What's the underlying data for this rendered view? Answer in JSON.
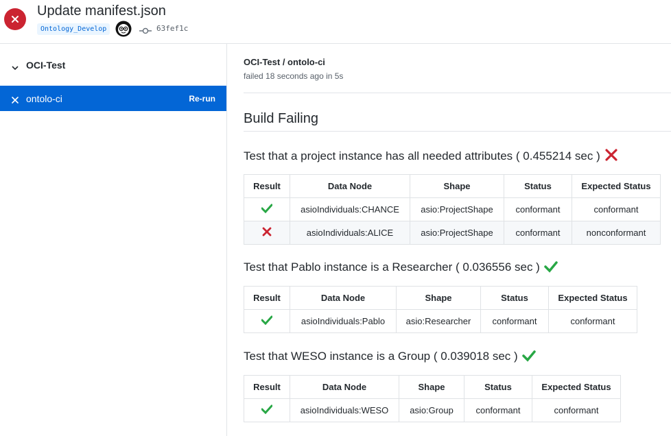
{
  "header": {
    "commit_title": "Update manifest.json",
    "branch": "Ontology_Develop",
    "sha": "63fef1c",
    "status_color": "#cb2431"
  },
  "sidebar": {
    "workflow_name": "OCI-Test",
    "job_name": "ontolo-ci",
    "rerun_label": "Re-run",
    "active_color": "#0366d6"
  },
  "main": {
    "job_path": "OCI-Test / ontolo-ci",
    "job_meta": "failed 18 seconds ago in 5s",
    "build_heading": "Build Failing",
    "column_headers": [
      "Result",
      "Data Node",
      "Shape",
      "Status",
      "Expected Status"
    ],
    "tests": [
      {
        "title": "Test that a project instance has all needed attributes ( 0.455214 sec )",
        "result_icon": "fail-icon",
        "rows": [
          {
            "result": "pass",
            "data_node": "asioIndividuals:CHANCE",
            "shape": "asio:ProjectShape",
            "status": "conformant",
            "expected": "conformant"
          },
          {
            "result": "fail",
            "data_node": "asioIndividuals:ALICE",
            "shape": "asio:ProjectShape",
            "status": "conformant",
            "expected": "nonconformant"
          }
        ]
      },
      {
        "title": "Test that Pablo instance is a Researcher ( 0.036556 sec )",
        "result_icon": "pass-icon",
        "rows": [
          {
            "result": "pass",
            "data_node": "asioIndividuals:Pablo",
            "shape": "asio:Researcher",
            "status": "conformant",
            "expected": "conformant"
          }
        ]
      },
      {
        "title": "Test that WESO instance is a Group ( 0.039018 sec )",
        "result_icon": "pass-icon",
        "rows": [
          {
            "result": "pass",
            "data_node": "asioIndividuals:WESO",
            "shape": "asio:Group",
            "status": "conformant",
            "expected": "conformant"
          }
        ]
      }
    ]
  },
  "colors": {
    "pass": "#28a745",
    "fail": "#cb2431"
  }
}
